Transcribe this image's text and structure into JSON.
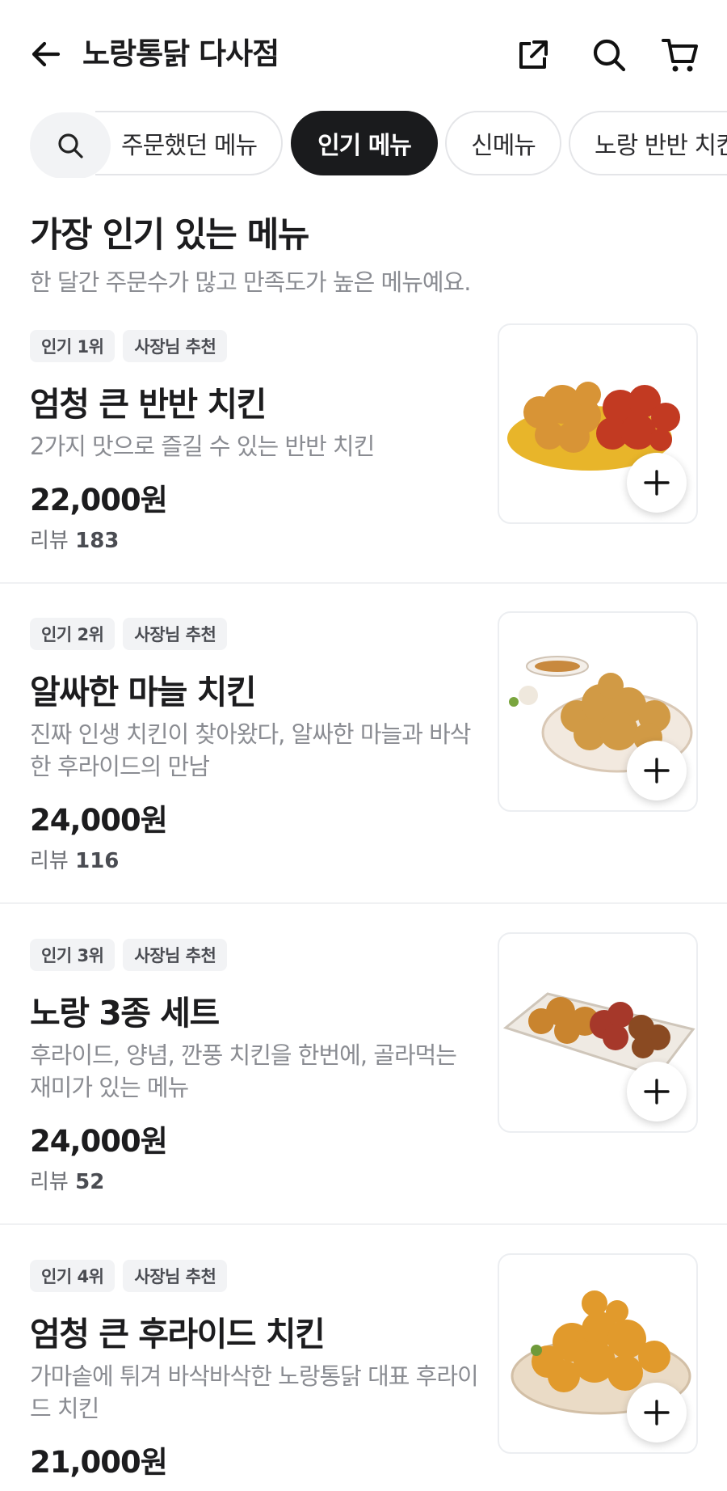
{
  "header": {
    "store_name": "노랑통닭 다사점",
    "icons": [
      "back-arrow-icon",
      "share-icon",
      "search-icon",
      "cart-icon"
    ]
  },
  "categories": {
    "chips": [
      "주문했던 메뉴",
      "인기 메뉴",
      "신메뉴",
      "노랑 반반 치킨"
    ],
    "active": "인기 메뉴"
  },
  "section": {
    "title": "가장 인기 있는 메뉴",
    "subtitle": "한 달간 주문수가 많고 만족도가 높은 메뉴예요."
  },
  "items": [
    {
      "rank": "인기 1위",
      "tag": "사장님 추천",
      "name": "엄청 큰 반반 치킨",
      "desc": "2가지 맛으로 즐길 수 있는 반반 치킨",
      "price": "22,000원",
      "review_label": "리뷰",
      "review_count": "183"
    },
    {
      "rank": "인기 2위",
      "tag": "사장님 추천",
      "name": "알싸한 마늘 치킨",
      "desc": "진짜 인생 치킨이 찾아왔다, 알싸한 마늘과 바삭한 후라이드의 만남",
      "price": "24,000원",
      "review_label": "리뷰",
      "review_count": "116"
    },
    {
      "rank": "인기 3위",
      "tag": "사장님 추천",
      "name": "노랑 3종 세트",
      "desc": "후라이드, 양념, 깐풍 치킨을 한번에, 골라먹는 재미가 있는 메뉴",
      "price": "24,000원",
      "review_label": "리뷰",
      "review_count": "52"
    },
    {
      "rank": "인기 4위",
      "tag": "사장님 추천",
      "name": "엄청 큰 후라이드 치킨",
      "desc": "가마솥에 튀겨 바삭바삭한 노랑통닭 대표 후라이드 치킨",
      "price": "21,000원"
    }
  ],
  "colors": {
    "active_chip": "#1a1b1d",
    "muted_text": "#8a8c92",
    "badge_bg": "#f2f3f5"
  }
}
